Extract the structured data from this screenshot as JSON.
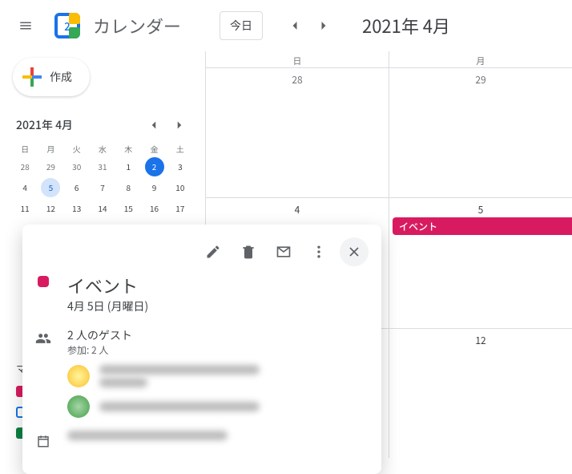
{
  "header": {
    "logo_day": "2",
    "app_title": "カレンダー",
    "today_label": "今日",
    "current_month": "2021年 4月"
  },
  "sidebar": {
    "create_label": "作成",
    "mini_cal": {
      "title": "2021年 4月",
      "dow": [
        "日",
        "月",
        "火",
        "水",
        "木",
        "金",
        "土"
      ],
      "days": [
        {
          "n": "28",
          "other": true
        },
        {
          "n": "29",
          "other": true
        },
        {
          "n": "30",
          "other": true
        },
        {
          "n": "31",
          "other": true
        },
        {
          "n": "1"
        },
        {
          "n": "2",
          "today": true
        },
        {
          "n": "3"
        },
        {
          "n": "4"
        },
        {
          "n": "5",
          "selected": true
        },
        {
          "n": "6"
        },
        {
          "n": "7"
        },
        {
          "n": "8"
        },
        {
          "n": "9"
        },
        {
          "n": "10"
        },
        {
          "n": "11"
        },
        {
          "n": "12"
        },
        {
          "n": "13"
        },
        {
          "n": "14"
        },
        {
          "n": "15"
        },
        {
          "n": "16"
        },
        {
          "n": "17"
        }
      ]
    },
    "my_calendars_label": "マ"
  },
  "grid": {
    "dow": [
      "日",
      "月"
    ],
    "weeks": [
      [
        {
          "n": "28"
        },
        {
          "n": "29"
        }
      ],
      [
        {
          "n": "4"
        },
        {
          "n": "5"
        }
      ],
      [
        {
          "n": ""
        },
        {
          "n": "12"
        }
      ]
    ],
    "event_label": "イベント"
  },
  "popup": {
    "title": "イベント",
    "date": "4月 5日 (月曜日)",
    "guests_title": "2 人のゲスト",
    "guests_sub": "参加: 2 人"
  }
}
